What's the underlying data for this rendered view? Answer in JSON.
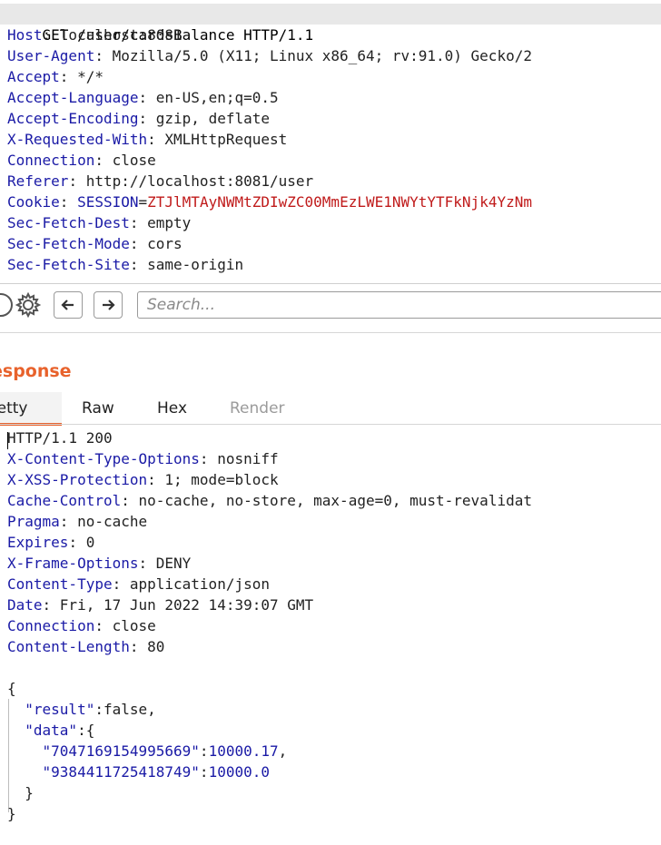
{
  "request": {
    "request_line": "GET /user/cardsBalance HTTP/1.1",
    "headers": [
      {
        "name": "Host",
        "value": "localhost:8081"
      },
      {
        "name": "User-Agent",
        "value": "Mozilla/5.0 (X11; Linux x86_64; rv:91.0) Gecko/2"
      },
      {
        "name": "Accept",
        "value": "*/*"
      },
      {
        "name": "Accept-Language",
        "value": "en-US,en;q=0.5"
      },
      {
        "name": "Accept-Encoding",
        "value": "gzip, deflate"
      },
      {
        "name": "X-Requested-With",
        "value": "XMLHttpRequest"
      },
      {
        "name": "Connection",
        "value": "close"
      },
      {
        "name": "Referer",
        "value": "http://localhost:8081/user"
      }
    ],
    "cookie": {
      "name": "Cookie",
      "cookie_name": "SESSION",
      "cookie_value": "ZTJlMTAyNWMtZDIwZC00MmEzLWE1NWYtYTFkNjk4YzNm"
    },
    "headers_after": [
      {
        "name": "Sec-Fetch-Dest",
        "value": "empty"
      },
      {
        "name": "Sec-Fetch-Mode",
        "value": "cors"
      },
      {
        "name": "Sec-Fetch-Site",
        "value": "same-origin"
      }
    ]
  },
  "toolbar": {
    "search_placeholder": "Search..."
  },
  "response": {
    "title": "esponse",
    "tabs": [
      {
        "label": "retty",
        "active": true
      },
      {
        "label": "Raw",
        "active": false
      },
      {
        "label": "Hex",
        "active": false
      },
      {
        "label": "Render",
        "active": false,
        "disabled": true
      }
    ],
    "status_line": "HTTP/1.1 200",
    "headers": [
      {
        "name": "X-Content-Type-Options",
        "value": "nosniff"
      },
      {
        "name": "X-XSS-Protection",
        "value": "1; mode=block"
      },
      {
        "name": "Cache-Control",
        "value": "no-cache, no-store, max-age=0, must-revalidat"
      },
      {
        "name": "Pragma",
        "value": "no-cache"
      },
      {
        "name": "Expires",
        "value": "0"
      },
      {
        "name": "X-Frame-Options",
        "value": "DENY"
      },
      {
        "name": "Content-Type",
        "value": "application/json"
      },
      {
        "name": "Date",
        "value": "Fri, 17 Jun 2022 14:39:07 GMT"
      },
      {
        "name": "Connection",
        "value": "close"
      },
      {
        "name": "Content-Length",
        "value": "80"
      }
    ],
    "body": {
      "open": "{",
      "result_key": "\"result\"",
      "result_value": "false",
      "data_key": "\"data\"",
      "entries": [
        {
          "key": "\"7047169154995669\"",
          "value": "10000.17",
          "trail": ","
        },
        {
          "key": "\"9384411725418749\"",
          "value": "10000.0",
          "trail": ""
        }
      ],
      "inner_close": "}",
      "close": "}"
    }
  },
  "colors": {
    "accent": "#e8622c",
    "header_key": "#1a1aa6",
    "cookie_value": "#c01b1b"
  },
  "icons": [
    "help-icon",
    "gear-icon",
    "arrow-left-icon",
    "arrow-right-icon"
  ]
}
